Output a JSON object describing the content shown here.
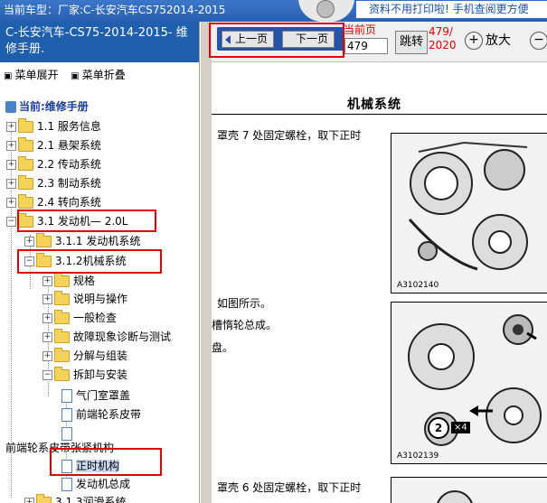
{
  "topbar": {
    "model_prefix": "当前车型：",
    "model_name": "厂家:C-长安汽车CS752014-2015",
    "promo": "资料不用打印啦! 手机查阅更方便"
  },
  "left_panel": {
    "car_title": "C-长安汽车-CS75-2014-2015- 维修手册.",
    "expand_label": "菜单展开",
    "collapse_label": "菜单折叠",
    "current_label": "当前:维修手册",
    "tree": [
      {
        "label": "1.1 服务信息",
        "level": 0
      },
      {
        "label": "2.1 悬架系统",
        "level": 0
      },
      {
        "label": "2.2 传动系统",
        "level": 0
      },
      {
        "label": "2.3 制动系统",
        "level": 0
      },
      {
        "label": "2.4 转向系统",
        "level": 0
      },
      {
        "label": "3.1 发动机— 2.0L",
        "level": 0
      },
      {
        "label": "3.1.1 发动机系统",
        "level": 1
      },
      {
        "label": "3.1.2机械系统",
        "level": 1
      },
      {
        "label": "规格",
        "level": 2
      },
      {
        "label": "说明与操作",
        "level": 2
      },
      {
        "label": "一般检查",
        "level": 2
      },
      {
        "label": "故障现象诊断与测试",
        "level": 2
      },
      {
        "label": "分解与组装",
        "level": 2
      },
      {
        "label": "拆卸与安装",
        "level": 2
      },
      {
        "label": "气门室罩盖",
        "level": 3
      },
      {
        "label": "前端轮系皮带",
        "level": 3
      },
      {
        "label": "",
        "level": 3
      },
      {
        "label": "正时机构",
        "level": 3
      },
      {
        "label": "发动机总成",
        "level": 3
      },
      {
        "label": "3.1.3润滑系统",
        "level": 1
      }
    ],
    "tooltip": "前端轮系皮带张紧机构"
  },
  "toolbar": {
    "prev_label": "上一页",
    "next_label": "下一页",
    "page_label": "当前页",
    "page_value": "479",
    "jump_label": "跳转",
    "page_count_top": "479/",
    "page_count_bottom": "2020",
    "zoom_in_label": "放大",
    "zoom_out_icon": "−"
  },
  "document": {
    "title": "机械系统",
    "lines": [
      "罩壳 7 处固定螺栓，取下正时",
      "如图所示。",
      "槽惰轮总成。",
      "盘。",
      "罩壳 6 处固定螺栓，取下正时"
    ],
    "figure1_code": "A3102140",
    "figure2_code": "A3102139",
    "callout_number": "2",
    "callout_multiplier": "×4"
  },
  "colors": {
    "accent_blue": "#1f5fae",
    "highlight_red": "#e00000",
    "selection": "#c9d8f0"
  }
}
